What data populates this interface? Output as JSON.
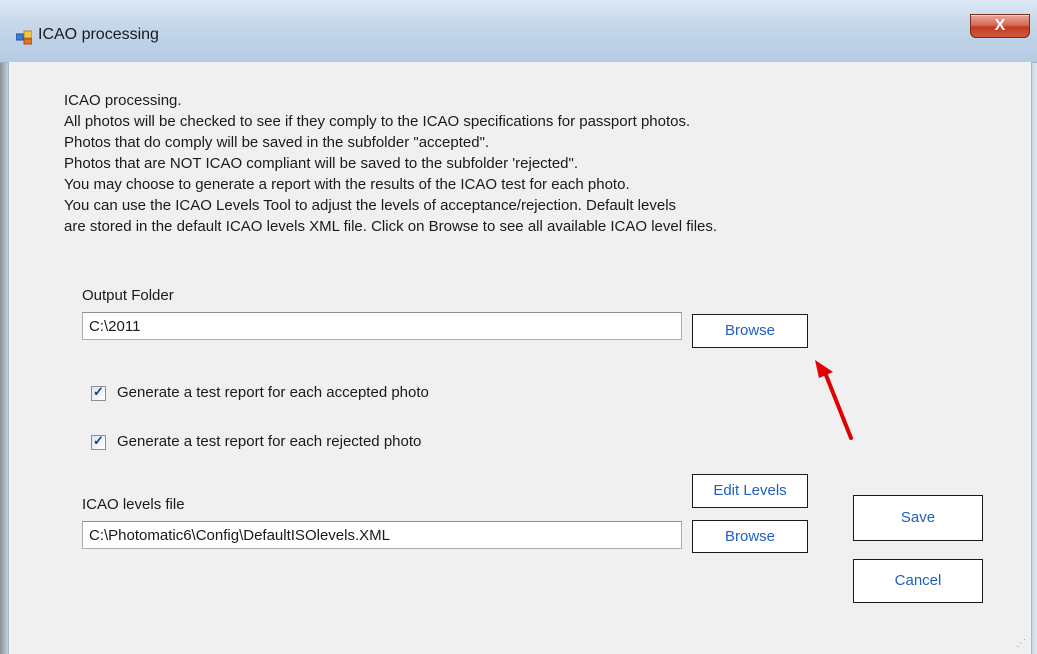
{
  "window": {
    "title": "ICAO processing",
    "close_glyph": "X",
    "icon": "app-window-icon"
  },
  "description": {
    "lines": [
      "ICAO processing.",
      "All photos will be checked to see if they comply to the ICAO specifications for passport photos.",
      "Photos that do comply will be saved in the subfolder \"accepted\".",
      "Photos that are NOT ICAO compliant will be saved to the subfolder 'rejected\".",
      "You may choose to generate a report with the results of the ICAO test for each photo.",
      "You can use the ICAO Levels Tool to adjust the levels of acceptance/rejection. Default levels",
      "are stored in the default ICAO levels XML file. Click on Browse to see all available ICAO level files."
    ]
  },
  "output_folder": {
    "label": "Output Folder",
    "value": "C:\\2011",
    "browse_label": "Browse"
  },
  "options": {
    "accepted_report": {
      "label": "Generate a test report for each accepted photo",
      "checked": true
    },
    "rejected_report": {
      "label": "Generate a test report for each rejected photo",
      "checked": true
    },
    "check_glyph": "✓"
  },
  "levels_file": {
    "label": "ICAO levels file",
    "value": "C:\\Photomatic6\\Config\\DefaultISOlevels.XML",
    "browse_label": "Browse",
    "edit_levels_label": "Edit Levels"
  },
  "actions": {
    "save_label": "Save",
    "cancel_label": "Cancel"
  },
  "colors": {
    "button_text": "#1f5fbf",
    "annotation_arrow": "#e00000"
  }
}
